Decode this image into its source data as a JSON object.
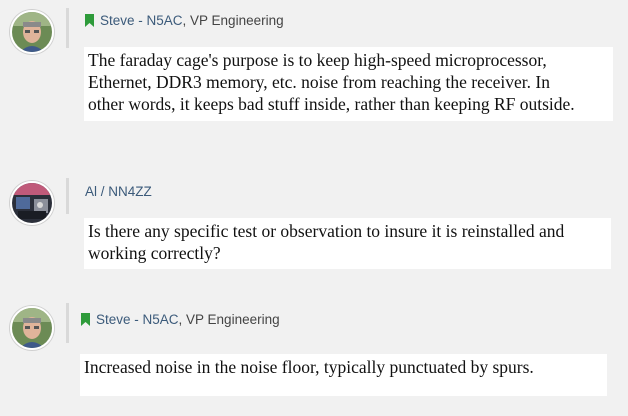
{
  "posts": [
    {
      "author": "Steve - N5AC",
      "title": ", VP Engineering",
      "lines": [
        "The faraday cage's purpose is to keep high-speed microprocessor,",
        "Ethernet, DDR3 memory, etc. noise from reaching the receiver. In",
        "other words, it keeps bad stuff inside, rather than keeping RF outside."
      ],
      "has_badge": true
    },
    {
      "author": "Al / NN4ZZ",
      "title": "",
      "lines": [
        "Is there any specific test or observation to insure it is reinstalled and",
        "working correctly?"
      ],
      "has_badge": false
    },
    {
      "author": "Steve - N5AC",
      "title": ", VP Engineering",
      "lines": [
        "Increased noise in the noise floor, typically punctuated by spurs."
      ],
      "has_badge": true
    }
  ],
  "colors": {
    "background": "#f1f1f1",
    "author_link": "#3b5a7a",
    "badge": "#2e9b3a",
    "message_bg": "#ffffff"
  },
  "icons": {
    "badge": "bookmark-icon",
    "avatar": "avatar"
  }
}
